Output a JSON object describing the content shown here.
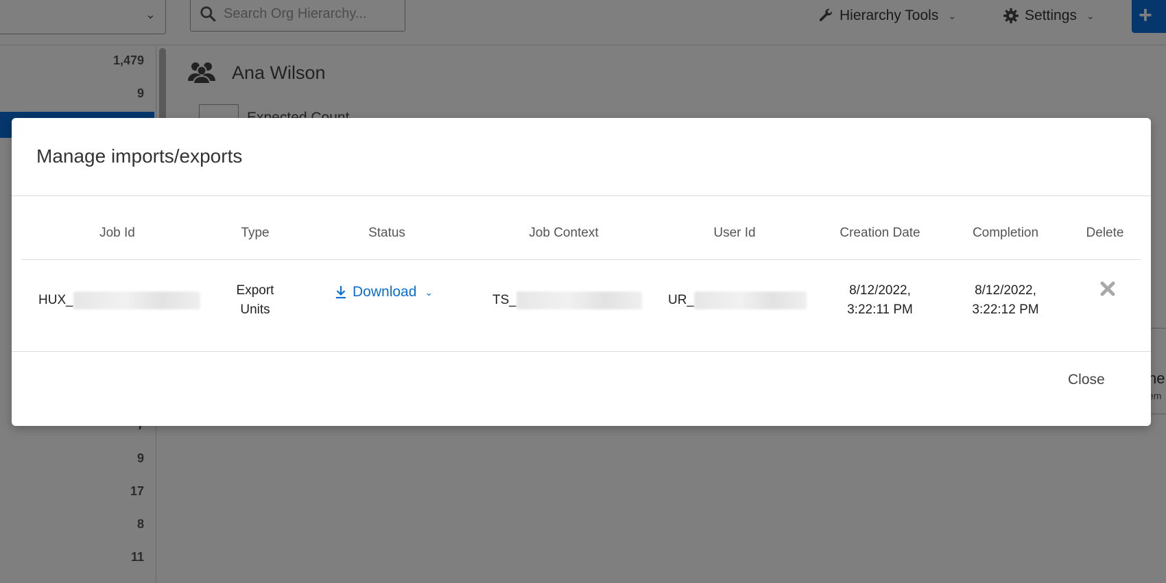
{
  "header": {
    "search_placeholder": "Search Org Hierarchy...",
    "hierarchy_tools_label": "Hierarchy Tools",
    "settings_label": "Settings",
    "add_label": "+"
  },
  "sidebar": {
    "counts": [
      "1,479",
      "9",
      "7",
      "9",
      "17",
      "8",
      "11"
    ]
  },
  "main": {
    "unit_name": "Ana Wilson",
    "sub_label": "Expected Count",
    "right_card_title": "ne",
    "right_card_sub": "em"
  },
  "modal": {
    "title": "Manage imports/exports",
    "columns": [
      "Job Id",
      "Type",
      "Status",
      "Job Context",
      "User Id",
      "Creation Date",
      "Completion",
      "Delete"
    ],
    "row": {
      "job_id_prefix": "HUX_",
      "type_line1": "Export",
      "type_line2": "Units",
      "status_label": "Download",
      "job_context_prefix": "TS_",
      "user_id_prefix": "UR_",
      "creation_date_line1": "8/12/2022,",
      "creation_date_line2": "3:22:11 PM",
      "completion_line1": "8/12/2022,",
      "completion_line2": "3:22:12 PM"
    },
    "close_label": "Close"
  },
  "colors": {
    "accent": "#0b6fd8",
    "overlay": "rgba(0,0,0,0.5)"
  },
  "icons": {
    "search": "search-icon",
    "wrench": "wrench-icon",
    "gear": "gear-icon",
    "users": "users-icon",
    "download": "download-icon",
    "delete": "close-x-icon"
  }
}
